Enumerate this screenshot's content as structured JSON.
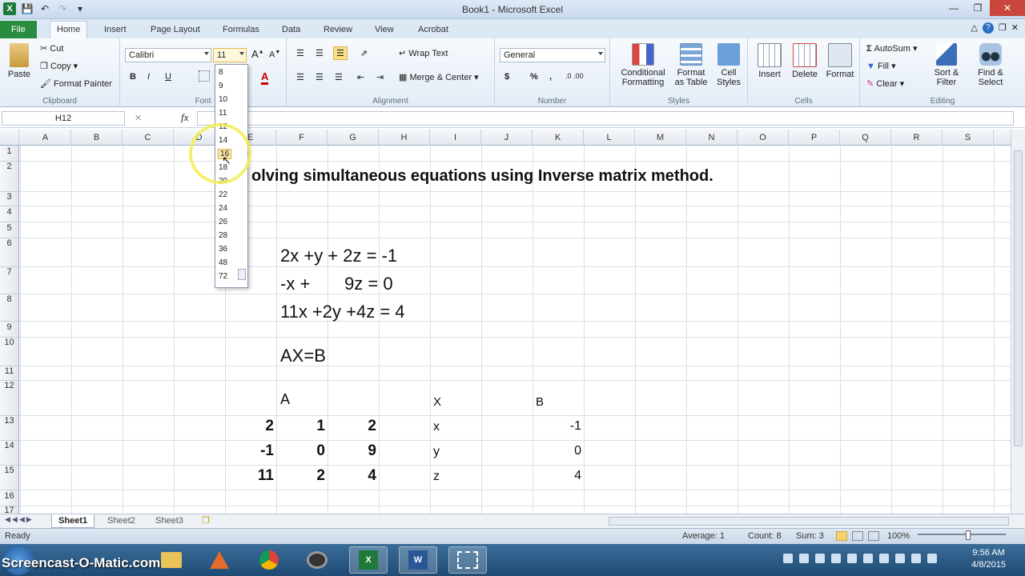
{
  "window": {
    "title": "Book1 - Microsoft Excel"
  },
  "ribbon_tabs": [
    "File",
    "Home",
    "Insert",
    "Page Layout",
    "Formulas",
    "Data",
    "Review",
    "View",
    "Acrobat"
  ],
  "clipboard": {
    "paste": "Paste",
    "cut": "Cut",
    "copy": "Copy",
    "format_painter": "Format Painter",
    "label": "Clipboard"
  },
  "font": {
    "name": "Calibri",
    "size": "11",
    "bold": "B",
    "italic": "I",
    "underline": "U",
    "label": "Font"
  },
  "alignment": {
    "wrap": "Wrap Text",
    "merge": "Merge & Center",
    "label": "Alignment"
  },
  "number": {
    "format": "General",
    "currency": "$",
    "percent": "%",
    "comma": ",",
    "label": "Number"
  },
  "styles": {
    "cond": "Conditional Formatting",
    "table": "Format as Table",
    "cell": "Cell Styles",
    "label": "Styles"
  },
  "cells": {
    "insert": "Insert",
    "delete": "Delete",
    "format": "Format",
    "label": "Cells"
  },
  "editing": {
    "autosum": "AutoSum",
    "fill": "Fill",
    "clear": "Clear",
    "sort": "Sort & Filter",
    "find": "Find & Select",
    "label": "Editing"
  },
  "formula_bar": {
    "name_box": "H12",
    "fx": "fx",
    "value": ""
  },
  "columns": [
    "A",
    "B",
    "C",
    "D",
    "E",
    "F",
    "G",
    "H",
    "I",
    "J",
    "K",
    "L",
    "M",
    "N",
    "O",
    "P",
    "Q",
    "R",
    "S"
  ],
  "rows": [
    "1",
    "2",
    "3",
    "4",
    "5",
    "6",
    "7",
    "8",
    "9",
    "10",
    "11",
    "12",
    "13",
    "14",
    "15",
    "16",
    "17"
  ],
  "font_sizes": [
    "8",
    "9",
    "10",
    "11",
    "12",
    "14",
    "16",
    "18",
    "20",
    "22",
    "24",
    "26",
    "28",
    "36",
    "48",
    "72"
  ],
  "sheet": {
    "heading": "olving simultaneous  equations using Inverse matrix method.",
    "eq1": "2x +y + 2z = -1",
    "eq2": "-x +       9z = 0",
    "eq3": "11x +2y +4z = 4",
    "axb": "AX=B",
    "label_a": "A",
    "label_x": "X",
    "label_b": "B",
    "matrix_a": [
      [
        "2",
        "1",
        "2"
      ],
      [
        "-1",
        "0",
        "9"
      ],
      [
        "11",
        "2",
        "4"
      ]
    ],
    "vector_x": [
      "x",
      "y",
      "z"
    ],
    "vector_b": [
      "-1",
      "0",
      "4"
    ]
  },
  "sheet_tabs": [
    "Sheet1",
    "Sheet2",
    "Sheet3"
  ],
  "status": {
    "ready": "Ready",
    "average": "Average: 1",
    "count": "Count: 8",
    "sum": "Sum: 3",
    "zoom": "100%"
  },
  "taskbar": {
    "watermark": "Screencast-O-Matic.com",
    "time": "9:56 AM",
    "date": "4/8/2015"
  }
}
